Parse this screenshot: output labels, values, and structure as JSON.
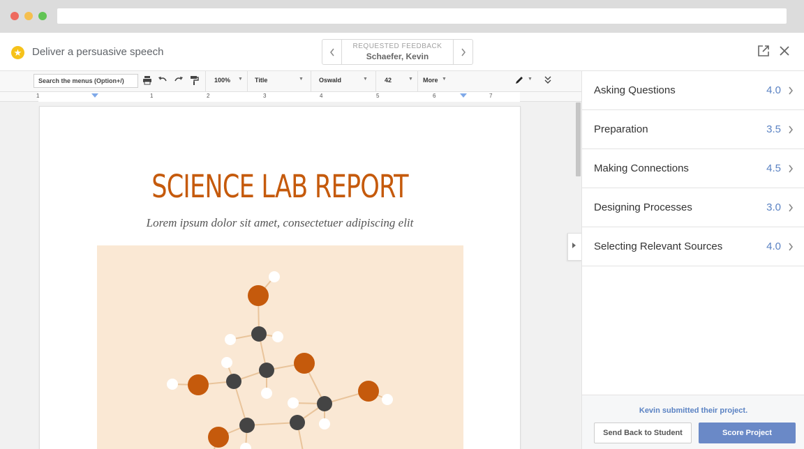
{
  "app_header": {
    "assignment_title": "Deliver a persuasive speech",
    "feedback_label": "REQUESTED FEEDBACK",
    "student_name": "Schaefer, Kevin",
    "icons": [
      "star-icon",
      "chevron-left-icon",
      "chevron-right-icon",
      "open-external-icon",
      "close-icon"
    ]
  },
  "toolbar": {
    "menu_search_placeholder": "Search the menus (Option+/)",
    "zoom": "100%",
    "style": "Title",
    "font": "Oswald",
    "font_size": "42",
    "more": "More",
    "icons": [
      "print-icon",
      "undo-icon",
      "redo-icon",
      "paint-format-icon",
      "pencil-icon",
      "collapse-toolbar-icon"
    ]
  },
  "ruler": {
    "numbers": [
      "1",
      "1",
      "2",
      "3",
      "4",
      "5",
      "6",
      "7"
    ]
  },
  "document": {
    "title": "SCIENCE LAB REPORT",
    "subtitle": "Lorem ipsum dolor sit amet, consectetuer adipiscing elit"
  },
  "rubric": {
    "items": [
      {
        "label": "Asking Questions",
        "score": "4.0"
      },
      {
        "label": "Preparation",
        "score": "3.5"
      },
      {
        "label": "Making Connections",
        "score": "4.5"
      },
      {
        "label": "Designing Processes",
        "score": "3.0"
      },
      {
        "label": "Selecting Relevant Sources",
        "score": "4.0"
      }
    ]
  },
  "footer": {
    "submitted_note": "Kevin submitted their project.",
    "send_back_label": "Send Back to Student",
    "score_label": "Score Project"
  },
  "colors": {
    "title_orange": "#c55a0c",
    "accent_blue": "#5a82c3",
    "score_button": "#6a89c7",
    "illustration_bg": "#fae8d4",
    "atom_orange": "#c55a0c",
    "atom_dark": "#444444"
  }
}
